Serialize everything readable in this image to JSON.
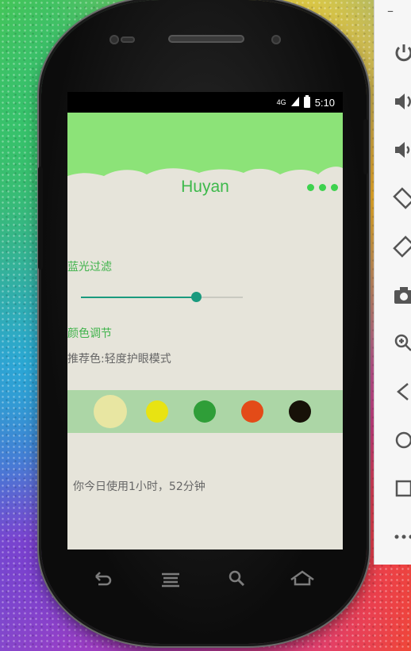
{
  "status_bar": {
    "network": "4G",
    "time": "5:10"
  },
  "app": {
    "title": "Huyan",
    "blue_light_label": "蓝光过滤",
    "blue_light_level": 0.71,
    "color_label": "颜色调节",
    "recommend_text": "推荐色:轻度护眼模式",
    "swatches": [
      "#e8e6a2",
      "#e8e312",
      "#2f9e38",
      "#e34b18",
      "#171108"
    ],
    "usage_text": "你今日使用1小时，52分钟",
    "header_color": "#8ce378",
    "accent_color": "#3db94b"
  },
  "emulator_panel": {
    "minimize_label": "–",
    "buttons": [
      "power-icon",
      "volume-up-icon",
      "volume-down-icon",
      "rotate-left-icon",
      "rotate-right-icon",
      "camera-icon",
      "zoom-icon",
      "back-icon",
      "home-icon",
      "overview-icon",
      "more-icon"
    ]
  }
}
